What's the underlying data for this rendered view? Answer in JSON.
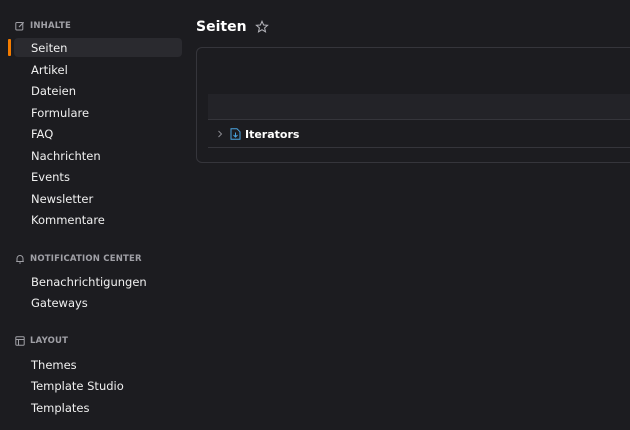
{
  "sidebar": {
    "groups": [
      {
        "title": "INHALTE",
        "icon": "edit-icon",
        "items": [
          "Seiten",
          "Artikel",
          "Dateien",
          "Formulare",
          "FAQ",
          "Nachrichten",
          "Events",
          "Newsletter",
          "Kommentare"
        ]
      },
      {
        "title": "NOTIFICATION CENTER",
        "icon": "bell-icon",
        "items": [
          "Benachrichtigungen",
          "Gateways"
        ]
      },
      {
        "title": "LAYOUT",
        "icon": "layout-icon",
        "items": [
          "Themes",
          "Template Studio",
          "Templates"
        ]
      }
    ],
    "active_item": "Seiten"
  },
  "main": {
    "title": "Seiten",
    "tree": {
      "rows": [
        {
          "label": "Iterators",
          "icon": "page-icon"
        }
      ]
    }
  },
  "colors": {
    "background": "#1c1c20",
    "accent": "#f47c00",
    "page_icon": "#4aa3e0",
    "border": "#35353b"
  }
}
